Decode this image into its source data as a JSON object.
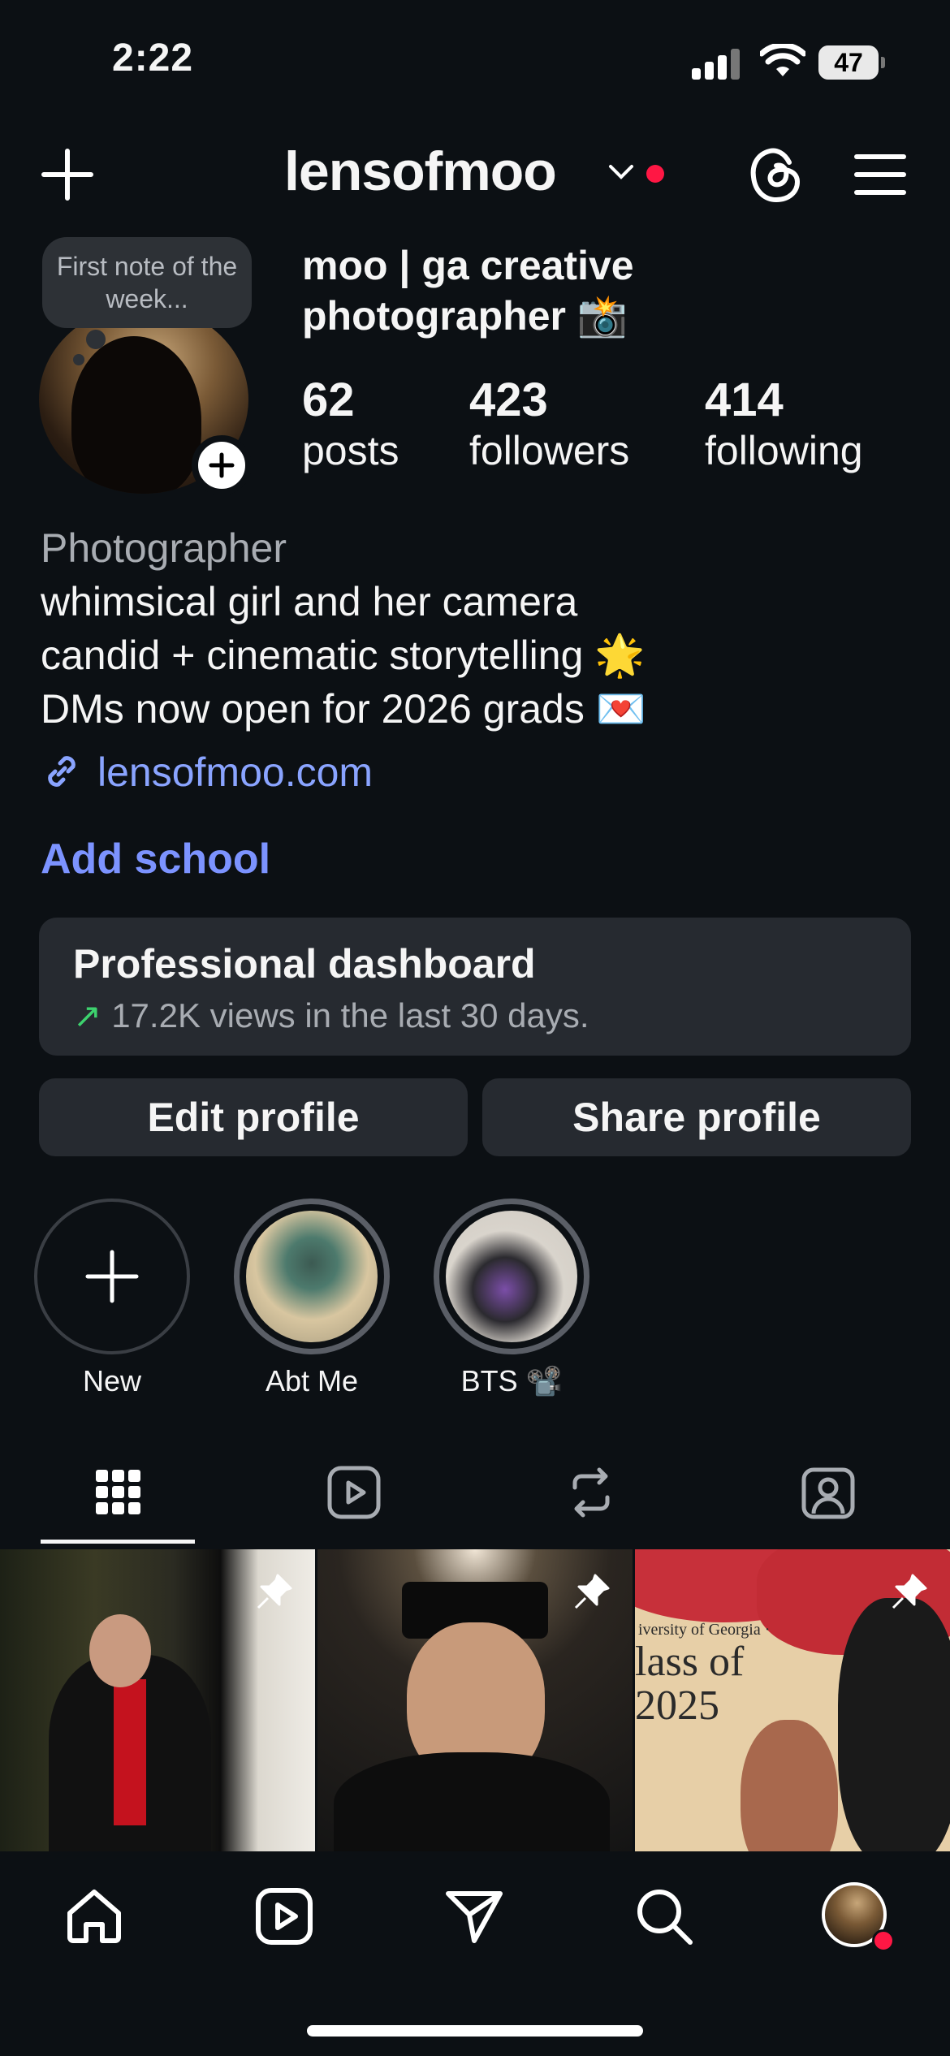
{
  "status_bar": {
    "time": "2:22",
    "battery": "47"
  },
  "header": {
    "username": "lensofmoo"
  },
  "note": {
    "text": "First note of the week..."
  },
  "profile": {
    "full_name": "moo | ga creative photographer 📸",
    "stats": [
      {
        "value": "62",
        "label": "posts"
      },
      {
        "value": "423",
        "label": "followers"
      },
      {
        "value": "414",
        "label": "following"
      }
    ],
    "category": "Photographer",
    "bio": [
      "whimsical girl and her camera",
      "candid + cinematic storytelling 🌟",
      "DMs now open for 2026 grads 💌"
    ],
    "link": "lensofmoo.com",
    "add_school": "Add school"
  },
  "dashboard": {
    "title": "Professional dashboard",
    "subtitle": "17.2K views in the last 30 days."
  },
  "buttons": {
    "edit": "Edit profile",
    "share": "Share profile"
  },
  "highlights": [
    {
      "label": "New"
    },
    {
      "label": "Abt Me"
    },
    {
      "label": "BTS 📽️"
    }
  ],
  "tabs": [
    "grid-icon",
    "reels-icon",
    "reposts-icon",
    "tagged-icon"
  ],
  "grid": {
    "post3_text_small": "iversity of Georgia ·",
    "post3_text_big": "lass of 2025"
  },
  "nav": [
    "home-icon",
    "reels-icon",
    "send-icon",
    "search-icon",
    "profile-avatar"
  ],
  "colors": {
    "background": "#0c1014",
    "accent_link": "#8aa4ff",
    "notification": "#ff1744"
  }
}
